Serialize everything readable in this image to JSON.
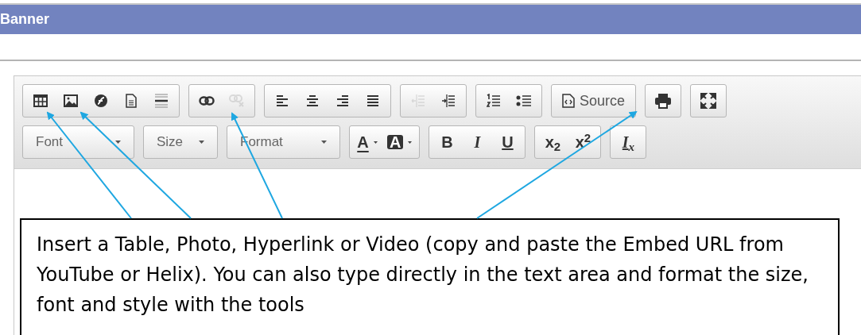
{
  "banner": {
    "title": "Banner"
  },
  "toolbar": {
    "rows": [
      {
        "groups": [
          {
            "buttons": [
              {
                "kind": "table",
                "disabled": false
              },
              {
                "kind": "image",
                "disabled": false
              },
              {
                "kind": "flash",
                "disabled": false
              },
              {
                "kind": "page",
                "disabled": false
              },
              {
                "kind": "rule",
                "disabled": false
              }
            ]
          },
          {
            "buttons": [
              {
                "kind": "link",
                "disabled": false
              },
              {
                "kind": "unlink",
                "disabled": true
              }
            ]
          },
          {
            "buttons": [
              {
                "kind": "align-left",
                "disabled": false
              },
              {
                "kind": "align-center",
                "disabled": false
              },
              {
                "kind": "align-right",
                "disabled": false
              },
              {
                "kind": "justify",
                "disabled": false
              }
            ]
          },
          {
            "buttons": [
              {
                "kind": "outdent",
                "disabled": true
              },
              {
                "kind": "indent",
                "disabled": false
              }
            ]
          },
          {
            "buttons": [
              {
                "kind": "numbered-list",
                "disabled": false
              },
              {
                "kind": "bulleted-list",
                "disabled": false
              }
            ]
          },
          {
            "buttons": [
              {
                "kind": "source",
                "label": "Source",
                "disabled": false
              }
            ]
          },
          {
            "buttons": [
              {
                "kind": "print",
                "disabled": false
              }
            ]
          },
          {
            "buttons": [
              {
                "kind": "maximize",
                "disabled": false
              }
            ]
          }
        ]
      },
      {
        "groups": [
          {
            "combo": "Font"
          },
          {
            "combo": "Size"
          },
          {
            "combo": "Format"
          },
          {
            "buttons": [
              {
                "kind": "text-color",
                "label": "A",
                "disabled": false
              },
              {
                "kind": "background-color",
                "label": "A",
                "disabled": false
              }
            ]
          },
          {
            "buttons": [
              {
                "kind": "bold",
                "label": "B",
                "disabled": false
              },
              {
                "kind": "italic",
                "label": "I",
                "disabled": false
              },
              {
                "kind": "underline",
                "label": "U",
                "disabled": false
              }
            ]
          },
          {
            "buttons": [
              {
                "kind": "subscript",
                "label": "x$_{2}$",
                "disabled": false
              },
              {
                "kind": "superscript",
                "label": "x$^{2}$",
                "disabled": false
              }
            ]
          },
          {
            "buttons": [
              {
                "kind": "remove-format",
                "label": "I$_{x}$",
                "disabled": false
              }
            ]
          }
        ]
      }
    ]
  },
  "callout": {
    "text": "Insert a Table, Photo, Hyperlink or Video (copy and paste the Embed URL from YouTube or Helix).  You can also type directly in the text area and format the size, font and style with the tools"
  }
}
